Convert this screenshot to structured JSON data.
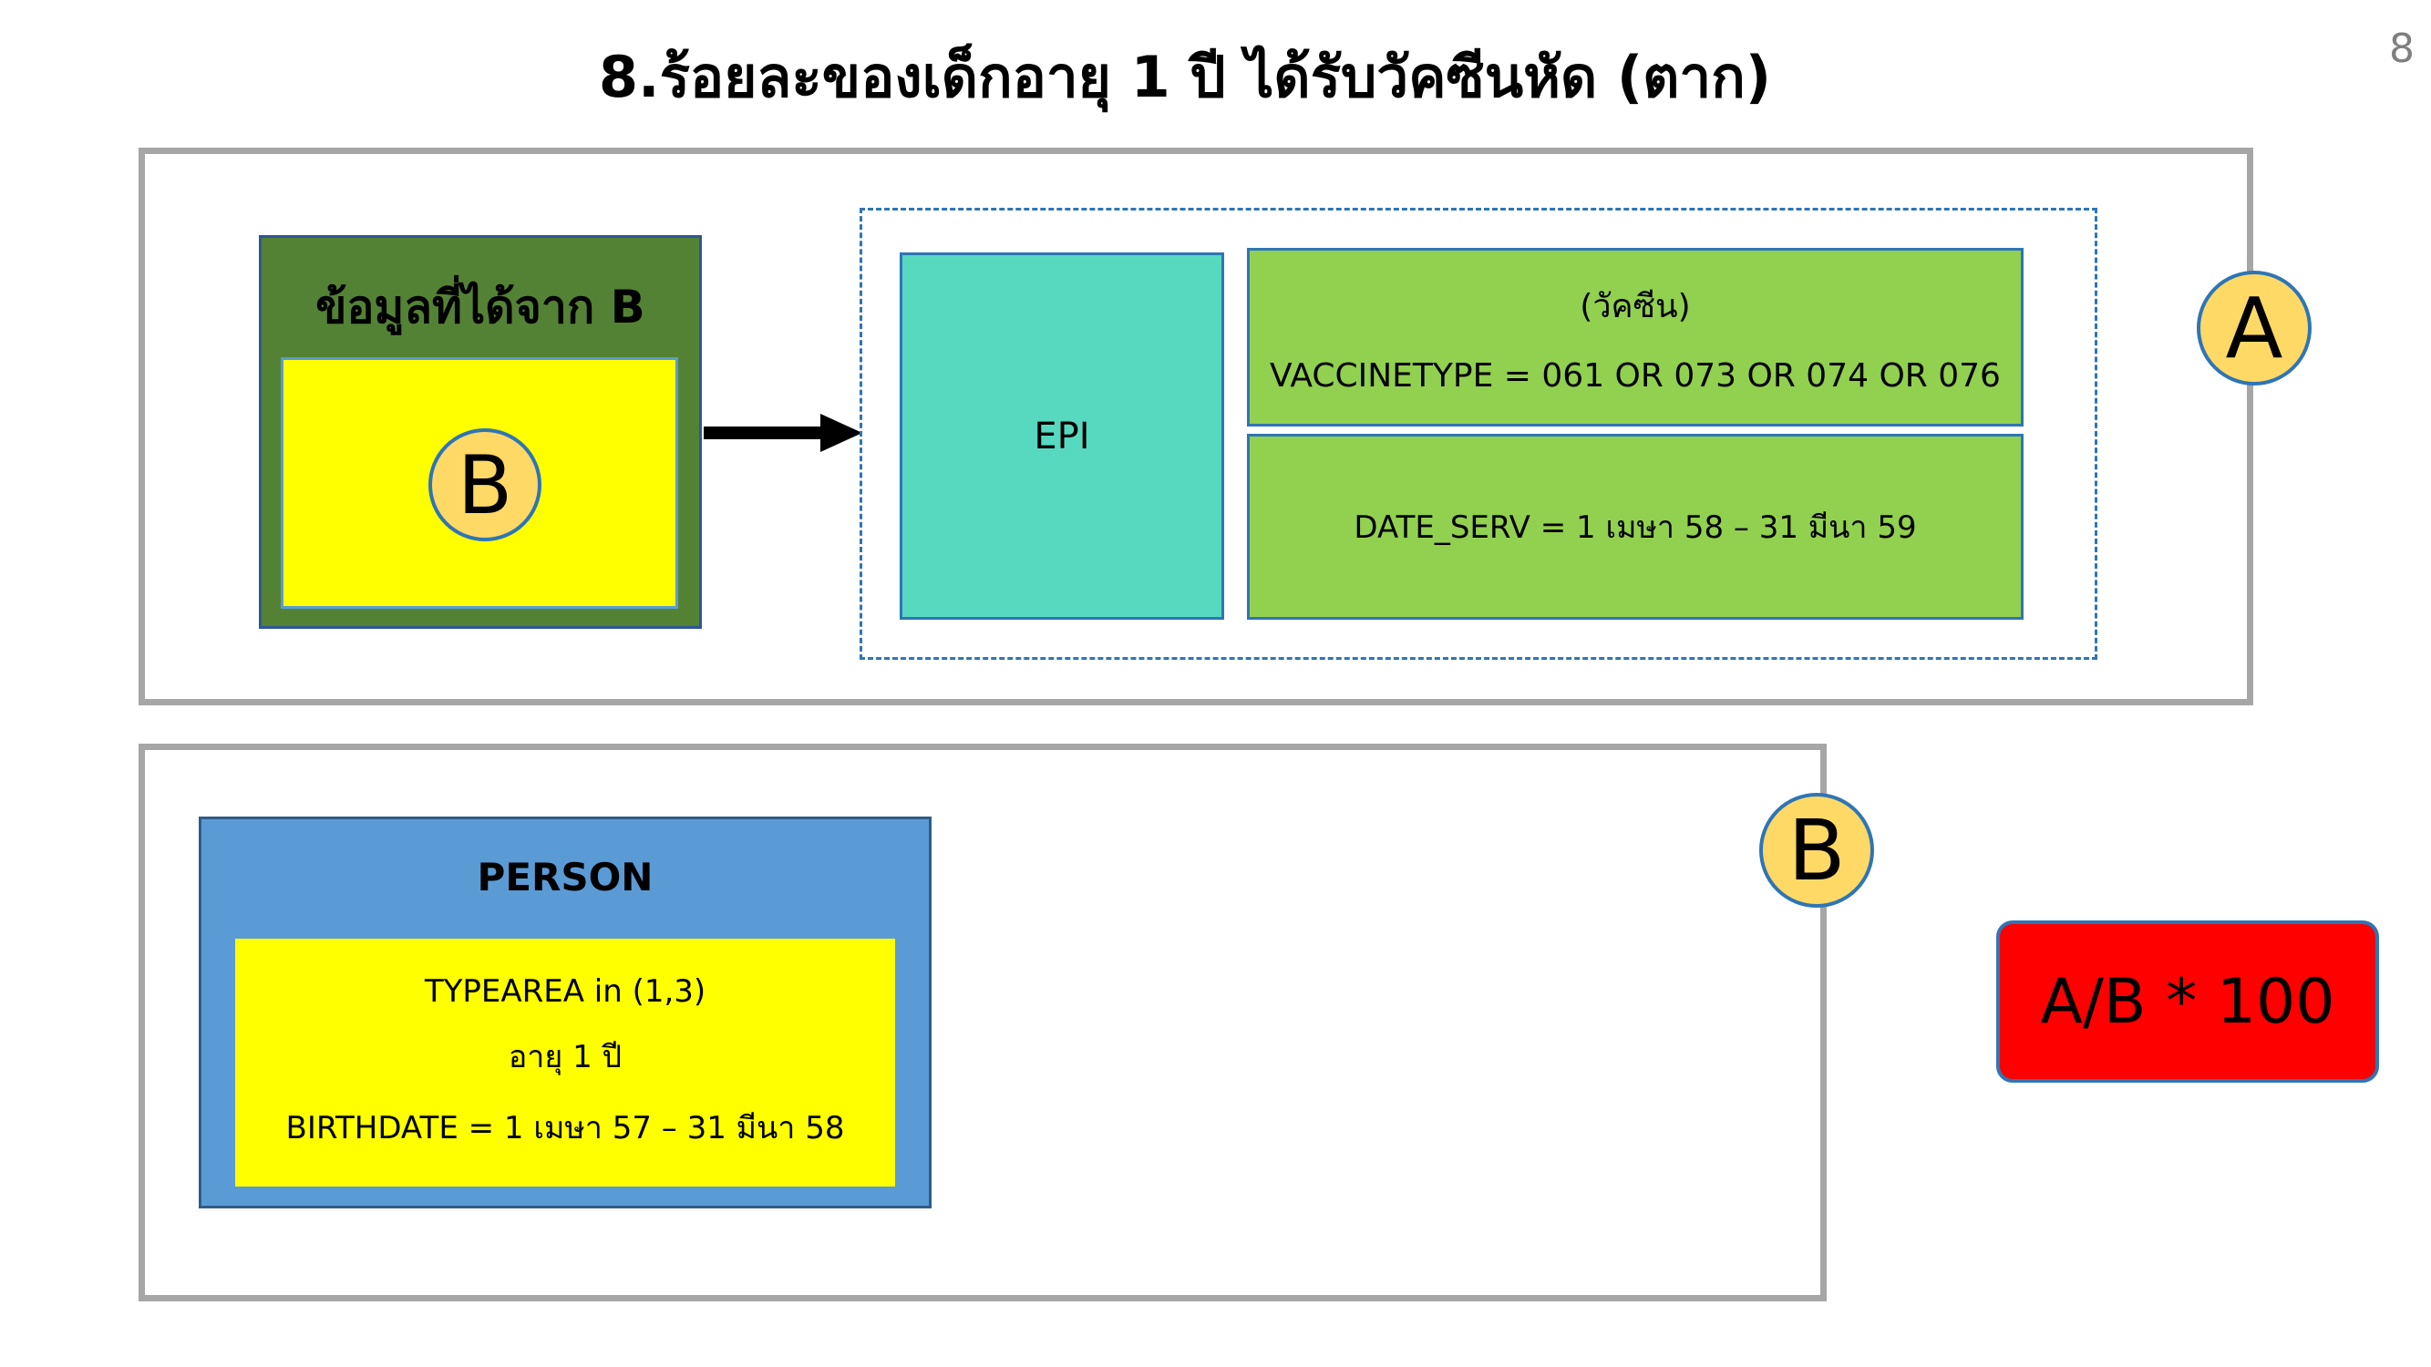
{
  "title": "8.ร้อยละของเด็กอายุ 1 ปี ได้รับวัคซีนหัด (ตาก)",
  "page_number": "8",
  "panel_a": {
    "badge": "A",
    "source_box": {
      "label": "ข้อมูลที่ได้จาก B",
      "badge": "B"
    },
    "epi_label": "EPI",
    "vaccine": {
      "heading": "(วัคซีน)",
      "condition": "VACCINETYPE = 061 OR 073 OR 074 OR 076"
    },
    "date_condition": "DATE_SERV = 1 เมษา 58 – 31 มีนา 59"
  },
  "panel_b": {
    "badge": "B",
    "person_label": "PERSON",
    "conditions": [
      "TYPEAREA in (1,3)",
      "อายุ 1 ปี",
      "BIRTHDATE = 1 เมษา 57 – 31 มีนา 58"
    ]
  },
  "formula": "A/B * 100",
  "colors": {
    "frame_border": "#a6a6a6",
    "source_outer": "#548235",
    "yellow_fill": "#ffff00",
    "badge_fill": "#ffd966",
    "epi_fill": "#57d9c0",
    "condition_fill": "#92d050",
    "person_fill": "#5b9bd5",
    "formula_fill": "#ff0000",
    "outline_blue": "#2e75b6"
  }
}
